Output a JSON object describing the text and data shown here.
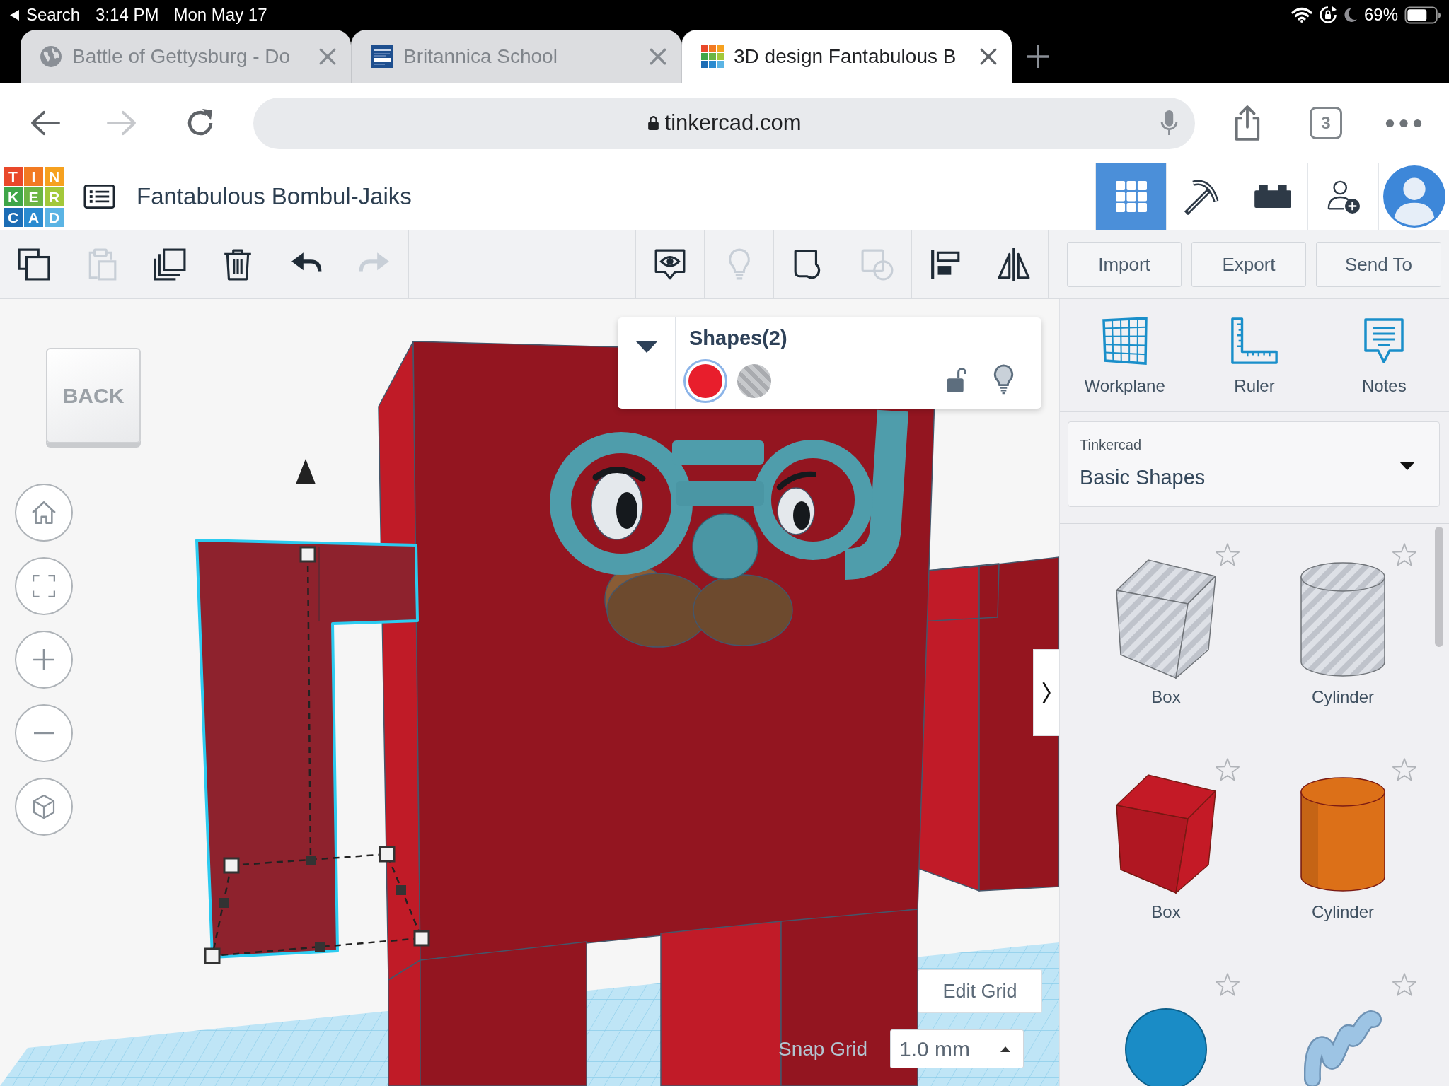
{
  "status_bar": {
    "back_label": "Search",
    "time": "3:14 PM",
    "date": "Mon May 17",
    "battery": "69%"
  },
  "browser_tabs": [
    {
      "kind": "globe",
      "title": "Battle of Gettysburg - Do",
      "selected": false
    },
    {
      "kind": "square-logo",
      "title": "Britannica School",
      "selected": false
    },
    {
      "kind": "tile-logo",
      "title": "3D design Fantabulous B",
      "selected": true
    }
  ],
  "address_bar": {
    "url": "tinkercad.com",
    "tab_count": "3"
  },
  "app_header": {
    "logo": [
      {
        "letter": "T",
        "color": "#e9482a"
      },
      {
        "letter": "I",
        "color": "#f27a22"
      },
      {
        "letter": "N",
        "color": "#f6a11f"
      },
      {
        "letter": "K",
        "color": "#3fa648"
      },
      {
        "letter": "E",
        "color": "#6cb544"
      },
      {
        "letter": "R",
        "color": "#a3c83a"
      },
      {
        "letter": "C",
        "color": "#1c6db5"
      },
      {
        "letter": "A",
        "color": "#2a8bd0"
      },
      {
        "letter": "D",
        "color": "#5bb4e4"
      }
    ],
    "title": "Fantabulous Bombul-Jaiks",
    "views": [
      {
        "kind": "grid",
        "selected": true
      },
      {
        "kind": "pickaxe",
        "selected": false
      },
      {
        "kind": "bricks",
        "selected": false
      }
    ],
    "account": [
      {
        "kind": "add-user"
      },
      {
        "kind": "avatar"
      }
    ]
  },
  "toolbar": {
    "left_groups": [
      {
        "tools": [
          {
            "kind": "copy",
            "disabled": false
          },
          {
            "kind": "paste",
            "disabled": true
          },
          {
            "kind": "duplicate",
            "disabled": false
          },
          {
            "kind": "delete",
            "disabled": false
          }
        ]
      },
      {
        "tools": [
          {
            "kind": "undo",
            "disabled": false
          },
          {
            "kind": "redo",
            "disabled": true
          }
        ]
      }
    ],
    "right_groups": [
      {
        "tools": [
          {
            "kind": "notes",
            "disabled": false
          }
        ]
      },
      {
        "tools": [
          {
            "kind": "bulb",
            "disabled": true
          }
        ]
      },
      {
        "tools": [
          {
            "kind": "group",
            "disabled": false
          },
          {
            "kind": "ungroup",
            "disabled": true
          }
        ]
      },
      {
        "tools": [
          {
            "kind": "align",
            "disabled": false
          },
          {
            "kind": "mirror",
            "disabled": false
          }
        ]
      }
    ],
    "actions": [
      "Import",
      "Export",
      "Send To"
    ]
  },
  "canvas": {
    "view_cube": "BACK",
    "nav_buttons": [
      {
        "kind": "home"
      },
      {
        "kind": "fit"
      },
      {
        "kind": "zoom-in"
      },
      {
        "kind": "zoom-out"
      },
      {
        "kind": "ortho"
      }
    ],
    "inspector": {
      "title": "Shapes(2)",
      "swatches": [
        {
          "kind": "solid",
          "color": "#e81e2c",
          "selected": true
        },
        {
          "kind": "hole",
          "selected": false
        }
      ],
      "locked": false
    },
    "edit_grid": "Edit Grid",
    "snap_grid": {
      "label": "Snap Grid",
      "value": "1.0 mm"
    }
  },
  "side_panel": {
    "tools": [
      {
        "kind": "workplane",
        "label": "Workplane"
      },
      {
        "kind": "ruler",
        "label": "Ruler"
      },
      {
        "kind": "notes",
        "label": "Notes"
      }
    ],
    "library": {
      "source": "Tinkercad",
      "category": "Basic Shapes"
    },
    "shapes": [
      {
        "kind": "box",
        "label": "Box",
        "hole": true,
        "favorite": false
      },
      {
        "kind": "cylinder",
        "label": "Cylinder",
        "hole": true,
        "favorite": false
      },
      {
        "kind": "box",
        "label": "Box",
        "hole": false,
        "color": "#c41a26",
        "favorite": false
      },
      {
        "kind": "cylinder",
        "label": "Cylinder",
        "hole": false,
        "color": "#dc7018",
        "favorite": false
      },
      {
        "kind": "sphere",
        "hole": false,
        "color": "#1a8cc6",
        "favorite": false
      },
      {
        "kind": "scribble",
        "hole": false,
        "color": "#9dc4e4",
        "favorite": false
      }
    ]
  }
}
